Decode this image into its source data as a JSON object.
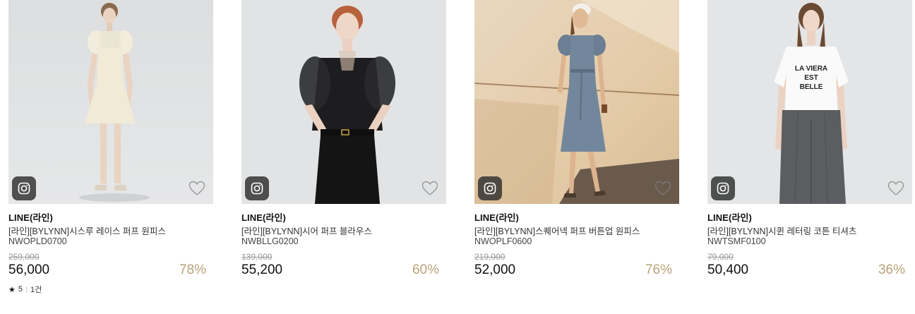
{
  "products": [
    {
      "brand": "LINE(라인)",
      "name": "[라인][BYLYNN]시스루 레이스 퍼프 원피스",
      "code": "NWOPLD0700",
      "original_price": "259,000",
      "price": "56,000",
      "discount": "78%",
      "image_desc": "cream-dress",
      "rating": {
        "score": "5",
        "count": "1건"
      }
    },
    {
      "brand": "LINE(라인)",
      "name": "[라인][BYLYNN]시어 퍼프 블라우스",
      "code": "NWBLLG0200",
      "original_price": "139,000",
      "price": "55,200",
      "discount": "60%",
      "image_desc": "black-blouse"
    },
    {
      "brand": "LINE(라인)",
      "name": "[라인][BYLYNN]스퀘어넥 퍼프 버튼업 원피스",
      "code": "NWOPLF0600",
      "original_price": "219,000",
      "price": "52,000",
      "discount": "76%",
      "image_desc": "blue-dress"
    },
    {
      "brand": "LINE(라인)",
      "name": "[라인][BYLYNN]시퀸 레터링 코튼 티셔츠",
      "code": "NWTSMF0100",
      "original_price": "79,000",
      "price": "50,400",
      "discount": "36%",
      "image_desc": "lettering-tee",
      "tee_text": [
        "LA VIERA",
        "EST",
        "BELLE"
      ]
    }
  ],
  "colors": {
    "discount": "#b8a27a",
    "badge_bg": "#2d2d2d"
  },
  "icons": {
    "instagram": "instagram-icon",
    "wishlist": "heart-outline-icon",
    "rating": "star-icon"
  }
}
